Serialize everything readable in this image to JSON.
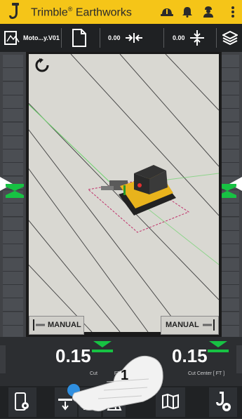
{
  "header": {
    "title": "Trimble",
    "title_mark": "®",
    "title_suffix": " Earthworks",
    "icons": [
      "excavator-logo-icon",
      "hardhat-icon",
      "bell-icon",
      "user-icon",
      "more-vert-icon"
    ]
  },
  "toolbar": {
    "design_name": "Moto...y.V01",
    "horizontal_offset": "0.00",
    "vertical_offset": "0.00"
  },
  "view": {
    "left_mode": "MANUAL",
    "right_mode": "MANUAL"
  },
  "status": {
    "left_value": "0.15",
    "left_label": "Cut",
    "left_label_tail": "FT",
    "right_value": "0.15",
    "right_label": "Cut Center",
    "right_unit": "[ FT ]"
  },
  "overlay": {
    "step_number": "1"
  },
  "colors": {
    "header_bg": "#f5c518",
    "accent_green": "#17c243",
    "machine_yellow": "#e8b31c",
    "target_dashed": "#c0306a"
  }
}
